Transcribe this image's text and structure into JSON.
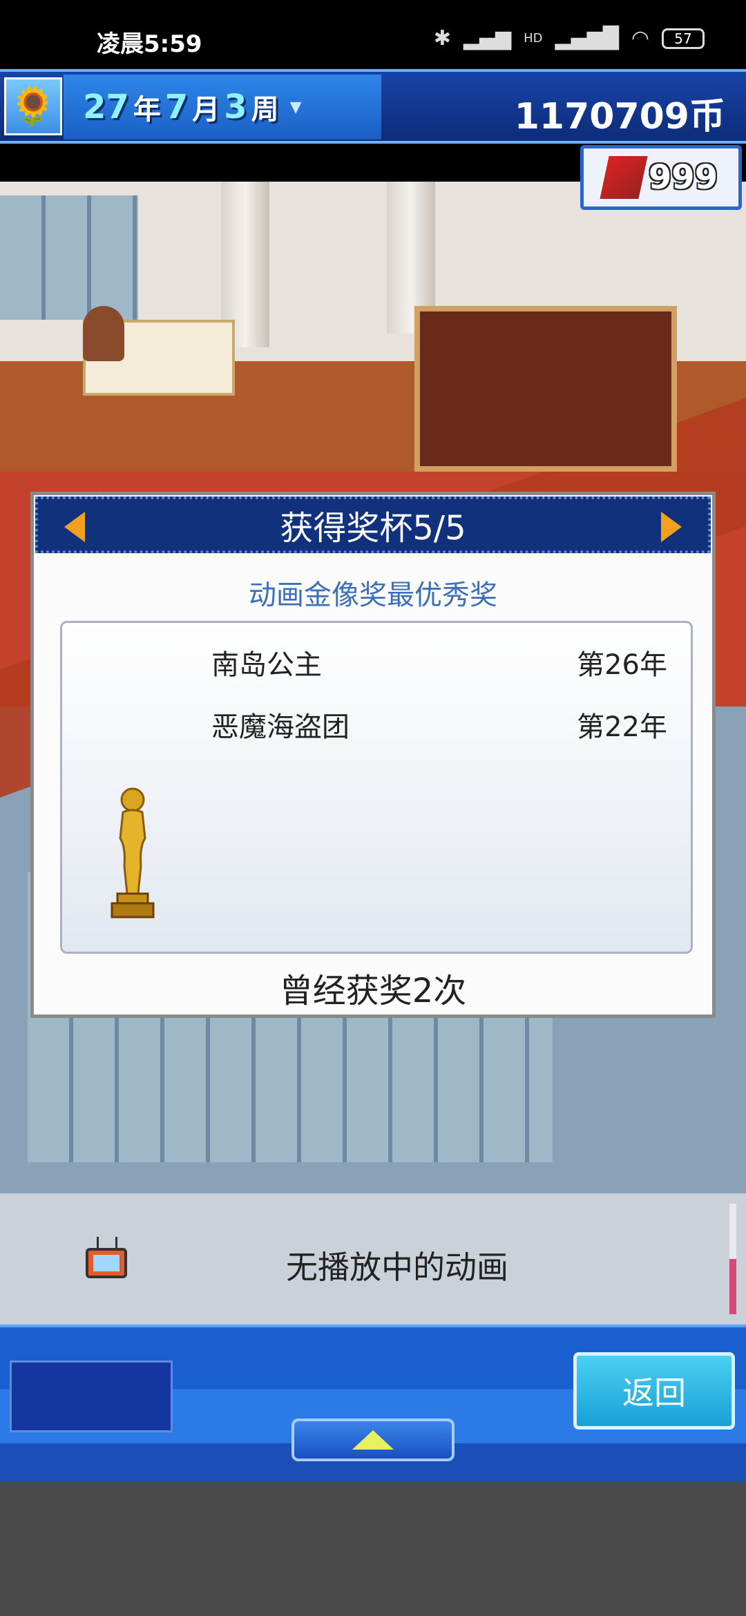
{
  "status_bar": {
    "time": "凌晨5:59",
    "battery": "57",
    "network": "HD"
  },
  "top_bar": {
    "date": {
      "year": "27",
      "year_unit": "年",
      "month": "7",
      "month_unit": "月",
      "week": "3",
      "week_unit": "周"
    },
    "money": "1170709币"
  },
  "tickets": {
    "count": "999"
  },
  "awards_dialog": {
    "title": "获得奖杯5/5",
    "award_name": "动画金像奖最优秀奖",
    "winners": [
      {
        "title": "南岛公主",
        "year": "第26年"
      },
      {
        "title": "恶魔海盗团",
        "year": "第22年"
      }
    ],
    "times_won": "曾经获奖2次"
  },
  "info_strip": {
    "message": "无播放中的动画"
  },
  "bottom_bar": {
    "back_label": "返回"
  },
  "colors": {
    "header_blue": "#12317c",
    "award_text": "#3c6fb6",
    "arrow_orange": "#f2a020",
    "back_button": "#1aa0d6"
  }
}
